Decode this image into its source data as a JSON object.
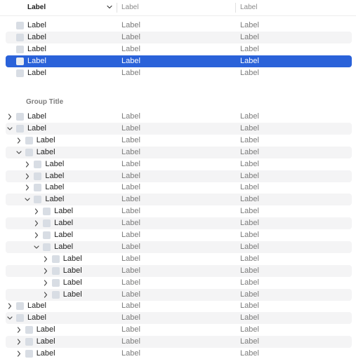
{
  "header": {
    "col1": "Label",
    "col2": "Label",
    "col3": "Label",
    "sort_icon": "chevron-down-icon"
  },
  "flat_rows": [
    {
      "label": "Label",
      "col2": "Label",
      "col3": "Label",
      "selected": false
    },
    {
      "label": "Label",
      "col2": "Label",
      "col3": "Label",
      "selected": false
    },
    {
      "label": "Label",
      "col2": "Label",
      "col3": "Label",
      "selected": false
    },
    {
      "label": "Label",
      "col2": "Label",
      "col3": "Label",
      "selected": true
    },
    {
      "label": "Label",
      "col2": "Label",
      "col3": "Label",
      "selected": false
    }
  ],
  "group": {
    "title": "Group Title",
    "rows": [
      {
        "label": "Label",
        "col2": "Label",
        "col3": "Label",
        "level": 0,
        "expanded": false
      },
      {
        "label": "Label",
        "col2": "Label",
        "col3": "Label",
        "level": 0,
        "expanded": true
      },
      {
        "label": "Label",
        "col2": "Label",
        "col3": "Label",
        "level": 1,
        "expanded": false
      },
      {
        "label": "Label",
        "col2": "Label",
        "col3": "Label",
        "level": 1,
        "expanded": true
      },
      {
        "label": "Label",
        "col2": "Label",
        "col3": "Label",
        "level": 2,
        "expanded": false
      },
      {
        "label": "Label",
        "col2": "Label",
        "col3": "Label",
        "level": 2,
        "expanded": false
      },
      {
        "label": "Label",
        "col2": "Label",
        "col3": "Label",
        "level": 2,
        "expanded": false
      },
      {
        "label": "Label",
        "col2": "Label",
        "col3": "Label",
        "level": 2,
        "expanded": true
      },
      {
        "label": "Label",
        "col2": "Label",
        "col3": "Label",
        "level": 3,
        "expanded": false
      },
      {
        "label": "Label",
        "col2": "Label",
        "col3": "Label",
        "level": 3,
        "expanded": false
      },
      {
        "label": "Label",
        "col2": "Label",
        "col3": "Label",
        "level": 3,
        "expanded": false
      },
      {
        "label": "Label",
        "col2": "Label",
        "col3": "Label",
        "level": 3,
        "expanded": true
      },
      {
        "label": "Label",
        "col2": "Label",
        "col3": "Label",
        "level": 4,
        "expanded": false
      },
      {
        "label": "Label",
        "col2": "Label",
        "col3": "Label",
        "level": 4,
        "expanded": false
      },
      {
        "label": "Label",
        "col2": "Label",
        "col3": "Label",
        "level": 4,
        "expanded": false
      },
      {
        "label": "Label",
        "col2": "Label",
        "col3": "Label",
        "level": 4,
        "expanded": false
      },
      {
        "label": "Label",
        "col2": "Label",
        "col3": "Label",
        "level": 0,
        "expanded": false
      },
      {
        "label": "Label",
        "col2": "Label",
        "col3": "Label",
        "level": 0,
        "expanded": true
      },
      {
        "label": "Label",
        "col2": "Label",
        "col3": "Label",
        "level": 1,
        "expanded": false
      },
      {
        "label": "Label",
        "col2": "Label",
        "col3": "Label",
        "level": 1,
        "expanded": false
      },
      {
        "label": "Label",
        "col2": "Label",
        "col3": "Label",
        "level": 1,
        "expanded": false
      }
    ]
  },
  "colors": {
    "selection": "#2a62d9",
    "zebra": "#f4f4f5",
    "icon": "#d8dde4",
    "secondary_text": "#7b7b7b"
  },
  "icons": {
    "row_icon": "file-icon",
    "collapsed": "chevron-right-icon",
    "expanded": "chevron-down-icon"
  }
}
